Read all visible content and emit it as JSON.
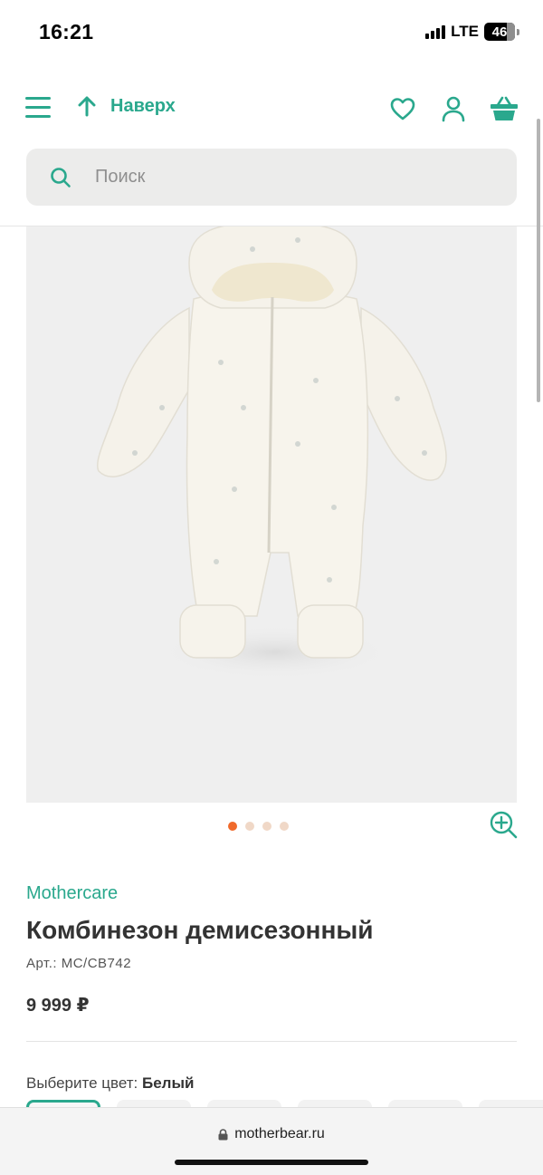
{
  "status_bar": {
    "time": "16:21",
    "network": "LTE",
    "battery": "46"
  },
  "header": {
    "up_label": "Наверх",
    "icons": [
      "menu-icon",
      "arrow-up-icon",
      "heart-icon",
      "user-icon",
      "basket-icon"
    ]
  },
  "search": {
    "placeholder": "Поиск"
  },
  "gallery": {
    "image": "baby-snowsuit-photo",
    "total_images": 4,
    "active_index": 0
  },
  "product": {
    "brand": "Mothercare",
    "title": "Комбинезон демисезонный",
    "sku": "Арт.: MC/CB742",
    "price": "9 999 ₽",
    "color_prompt": "Выберите цвет:",
    "color_value": "Белый"
  },
  "browser": {
    "url": "motherbear.ru"
  },
  "colors": {
    "accent": "#2aa88d",
    "dot_active": "#f06a2b",
    "dot_inactive": "#f0d8c7"
  }
}
